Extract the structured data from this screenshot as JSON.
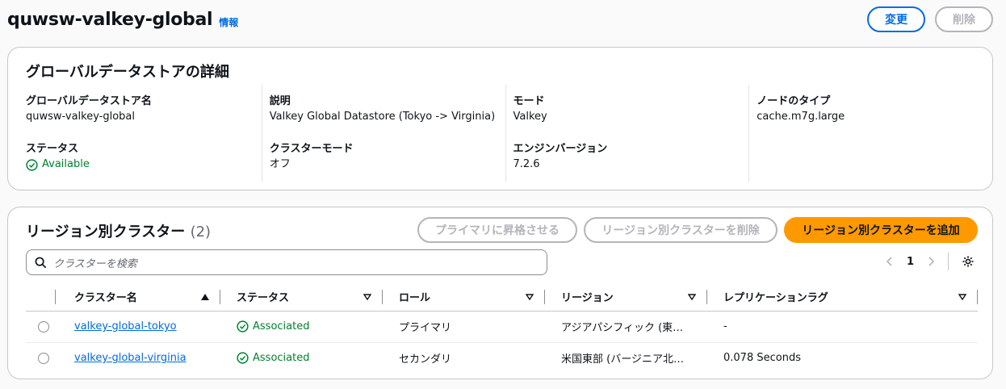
{
  "header": {
    "title": "quwsw-valkey-global",
    "info": "情報",
    "edit_label": "変更",
    "delete_label": "削除"
  },
  "details": {
    "title": "グローバルデータストアの詳細",
    "name_label": "グローバルデータストア名",
    "name_value": "quwsw-valkey-global",
    "status_label": "ステータス",
    "status_value": "Available",
    "desc_label": "説明",
    "desc_value": "Valkey Global Datastore (Tokyo -> Virginia)",
    "cluster_mode_label": "クラスターモード",
    "cluster_mode_value": "オフ",
    "mode_label": "モード",
    "mode_value": "Valkey",
    "engine_label": "エンジンバージョン",
    "engine_value": "7.2.6",
    "node_label": "ノードのタイプ",
    "node_value": "cache.m7g.large"
  },
  "regional": {
    "title": "リージョン別クラスター",
    "count": "(2)",
    "promote_label": "プライマリに昇格させる",
    "remove_label": "リージョン別クラスターを削除",
    "add_label": "リージョン別クラスターを追加",
    "search_placeholder": "クラスターを検索",
    "page": "1",
    "columns": [
      "クラスター名",
      "ステータス",
      "ロール",
      "リージョン",
      "レプリケーションラグ"
    ],
    "rows": [
      {
        "name": "valkey-global-tokyo",
        "status": "Associated",
        "role": "プライマリ",
        "region": "アジアパシフィック (東…",
        "lag": "-"
      },
      {
        "name": "valkey-global-virginia",
        "status": "Associated",
        "role": "セカンダリ",
        "region": "米国東部 (バージニア北…",
        "lag": "0.078 Seconds"
      }
    ]
  },
  "colors": {
    "accent": "#006ce0",
    "primary_button": "#ff9900",
    "success": "#00802f"
  }
}
